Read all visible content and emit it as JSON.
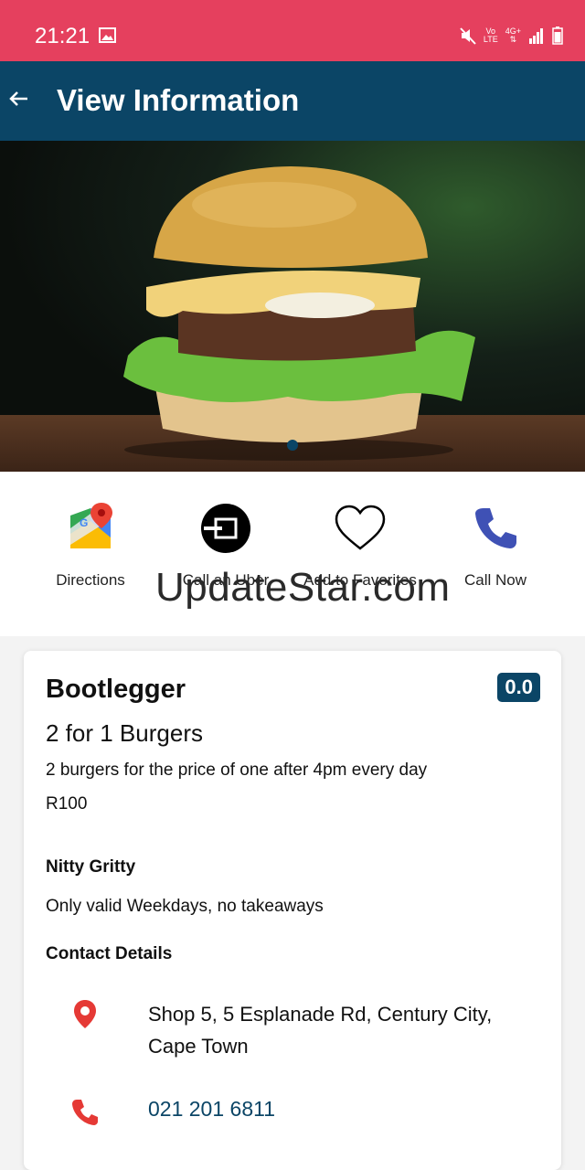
{
  "status_bar": {
    "time": "21:21",
    "net_top": "Vo",
    "net_bottom": "LTE",
    "net_type": "4G+"
  },
  "app_bar": {
    "title": "View Information",
    "back_icon": "arrow-left-icon"
  },
  "actions": [
    {
      "label": "Directions",
      "icon": "google-maps-icon"
    },
    {
      "label": "Call an Uber",
      "icon": "uber-icon"
    },
    {
      "label": "Add to Favorites",
      "icon": "heart-icon"
    },
    {
      "label": "Call Now",
      "icon": "phone-icon"
    }
  ],
  "watermark": "UpdateStar.com",
  "card": {
    "name": "Bootlegger",
    "rating": "0.0",
    "deal": "2 for 1 Burgers",
    "description": "2 burgers for the price of one after 4pm every day",
    "price": "R100",
    "nitty_heading": "Nitty Gritty",
    "nitty_text": "Only valid Weekdays, no takeaways",
    "contact_heading": "Contact Details",
    "address": "Shop 5, 5 Esplanade Rd, Century City, Cape Town",
    "phone": "021 201 6811"
  },
  "colors": {
    "status_bar": "#e5405e",
    "app_bar": "#0b4566",
    "accent_red": "#e53935"
  }
}
